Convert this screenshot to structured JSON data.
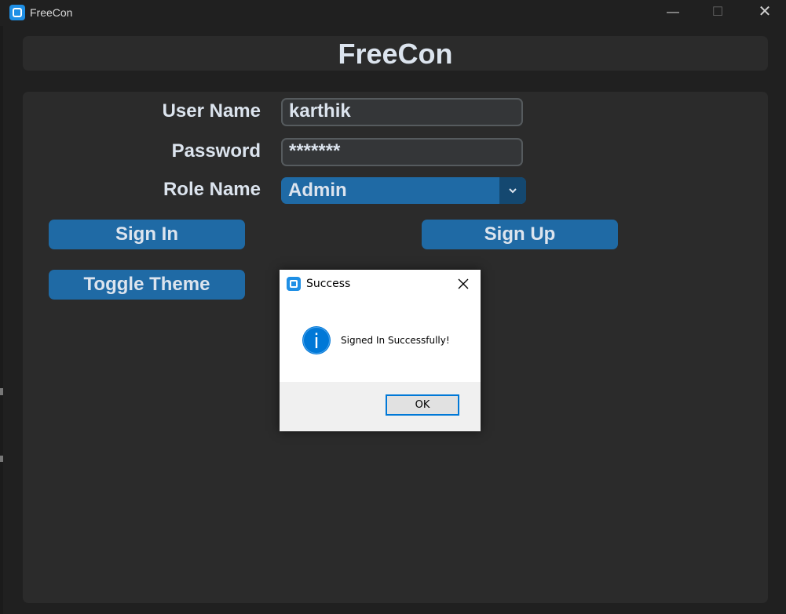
{
  "window": {
    "title": "FreeCon",
    "minimize": "—",
    "maximize": "☐",
    "close": "✕"
  },
  "header": {
    "app_title": "FreeCon"
  },
  "form": {
    "username_label": "User Name",
    "username_value": "karthik",
    "password_label": "Password",
    "password_value": "*******",
    "role_label": "Role Name",
    "role_value": "Admin"
  },
  "buttons": {
    "sign_in": "Sign In",
    "sign_up": "Sign Up",
    "toggle_theme": "Toggle Theme"
  },
  "dialog": {
    "title": "Success",
    "message": "Signed In Successfully!",
    "ok": "OK"
  },
  "colors": {
    "accent": "#1f6aa5",
    "accent_dark": "#144870",
    "panel": "#2b2b2b",
    "background": "#202020",
    "text": "#dce4ee",
    "info_blue": "#0078d7"
  },
  "icons": {
    "app": "app-icon",
    "dropdown": "chevron-down-icon",
    "dialog_close": "close-icon",
    "info": "info-icon"
  }
}
